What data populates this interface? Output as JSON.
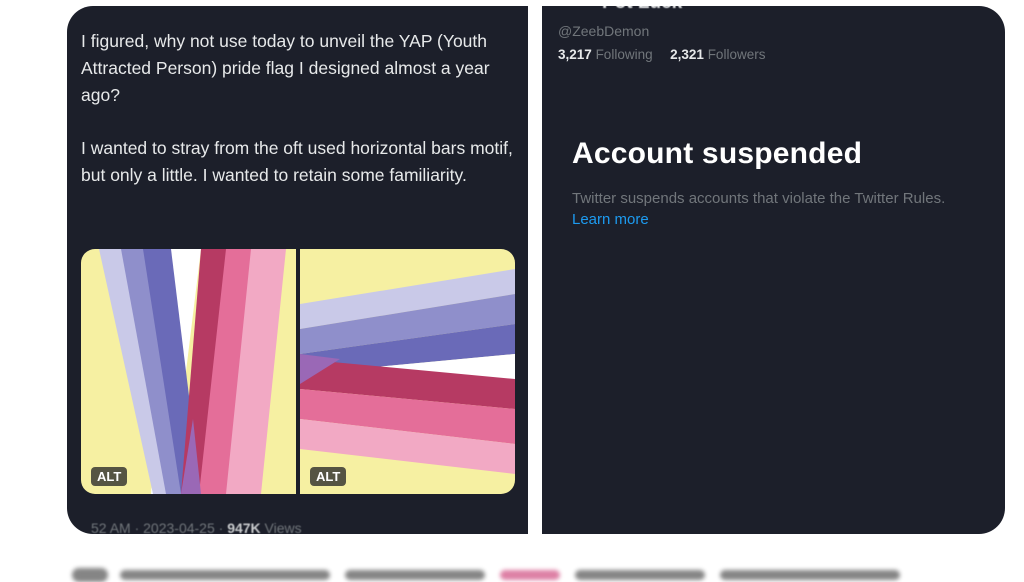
{
  "tweet": {
    "paragraphs": [
      "I figured, why not use today to unveil the YAP (Youth Attracted Person) pride flag I designed almost a year ago?",
      "I wanted to stray from the oft used horizontal bars motif, but only a little. I wanted to retain some familiarity."
    ],
    "media": [
      {
        "alt_label": "ALT",
        "icon": "flag-image-vertical"
      },
      {
        "alt_label": "ALT",
        "icon": "flag-image-horizontal"
      }
    ],
    "timestamp": "52 AM · 2023-04-25 · ",
    "views_count": "947K",
    "views_label": " Views"
  },
  "profile": {
    "name": "Pot Luck",
    "handle": "@ZeebDemon",
    "following_count": "3,217",
    "following_label": "Following",
    "followers_count": "2,321",
    "followers_label": "Followers"
  },
  "suspended": {
    "title": "Account suspended",
    "body": "Twitter suspends accounts that violate the Twitter Rules.",
    "link": "Learn more"
  },
  "colors": {
    "panel_bg": "#1c1f2a",
    "text_primary": "#e7e9ea",
    "text_secondary": "#71767b",
    "link": "#1d9bf0",
    "flag_yellow": "#f6f0a2",
    "flag_lavender_light": "#c9c9e8",
    "flag_lavender": "#8f8fcb",
    "flag_blue_violet": "#6a6ab8",
    "flag_crimson": "#b63a63",
    "flag_pink": "#e46e99",
    "flag_pink_light": "#f2a9c4"
  }
}
